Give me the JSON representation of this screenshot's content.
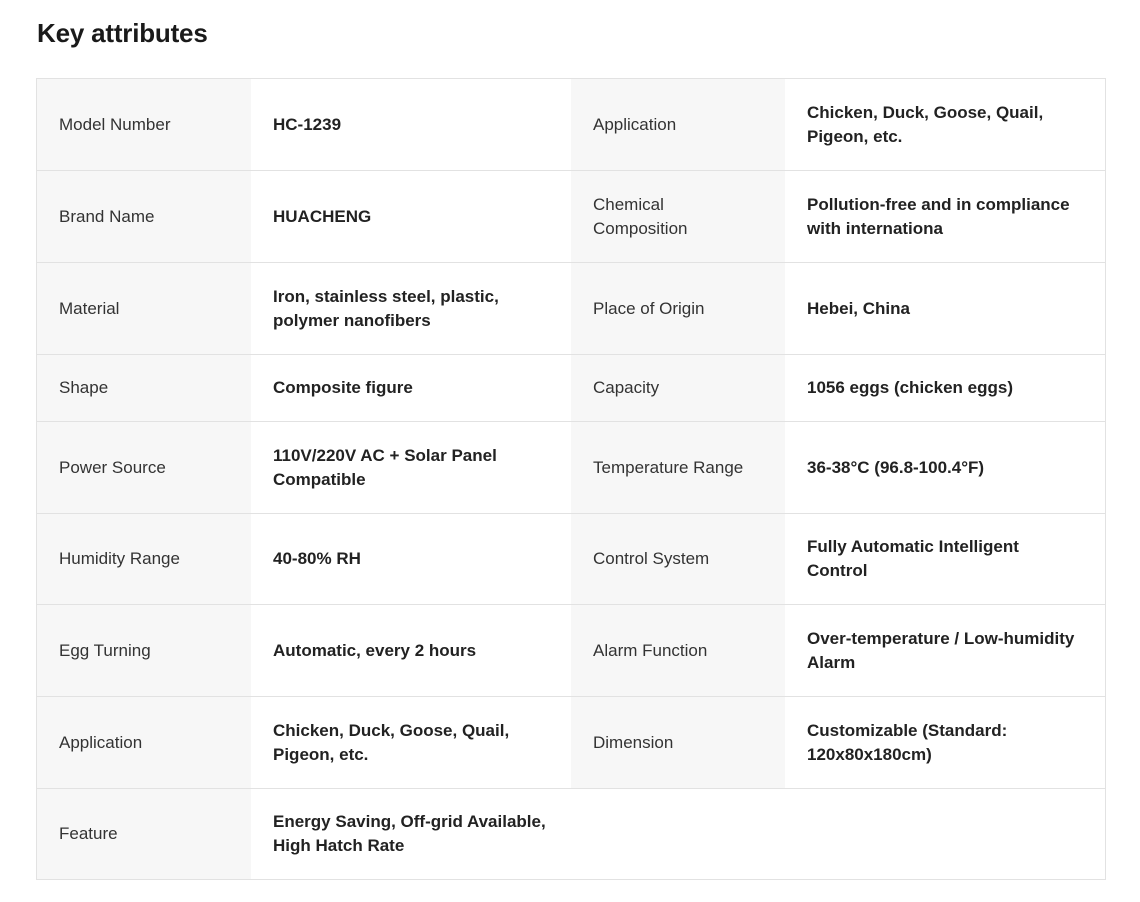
{
  "title": "Key attributes",
  "rows": [
    {
      "k1": "Model Number",
      "v1": "HC-1239",
      "k2": "Application",
      "v2": "Chicken, Duck, Goose, Quail, Pigeon, etc."
    },
    {
      "k1": "Brand Name",
      "v1": "HUACHENG",
      "k2": "Chemical Composition",
      "v2": "Pollution-free and in compliance with internationa"
    },
    {
      "k1": "Material",
      "v1": "Iron, stainless steel, plastic, polymer nanofibers",
      "k2": "Place of Origin",
      "v2": "Hebei, China"
    },
    {
      "k1": "Shape",
      "v1": "Composite figure",
      "k2": "Capacity",
      "v2": "1056 eggs (chicken eggs)"
    },
    {
      "k1": "Power Source",
      "v1": "110V/220V AC + Solar Panel Compatible",
      "k2": "Temperature Range",
      "v2": "36-38°C (96.8-100.4°F)"
    },
    {
      "k1": "Humidity Range",
      "v1": "40-80% RH",
      "k2": "Control System",
      "v2": "Fully Automatic Intelligent Control"
    },
    {
      "k1": "Egg Turning",
      "v1": "Automatic, every 2 hours",
      "k2": "Alarm Function",
      "v2": "Over-temperature / Low-humidity Alarm"
    },
    {
      "k1": "Application",
      "v1": "Chicken, Duck, Goose, Quail, Pigeon, etc.",
      "k2": "Dimension",
      "v2": "Customizable (Standard: 120x80x180cm)"
    },
    {
      "k1": "Feature",
      "v1": "Energy Saving, Off-grid Available, High Hatch Rate"
    }
  ]
}
